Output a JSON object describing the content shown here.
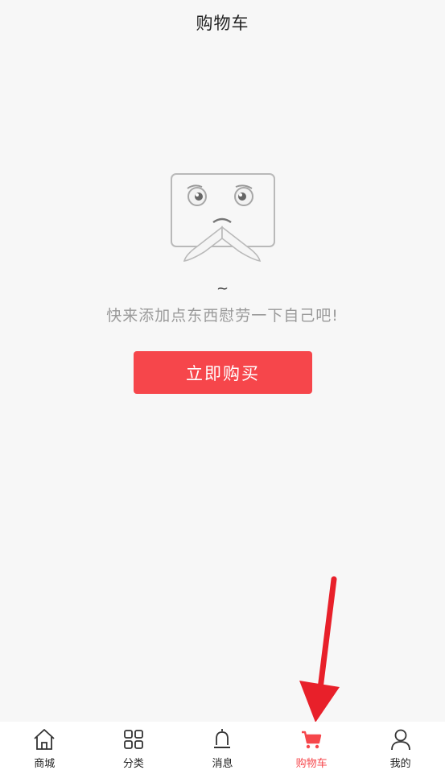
{
  "header": {
    "title": "购物车"
  },
  "empty_state": {
    "tilde": "~",
    "message": "快来添加点东西慰劳一下自己吧!",
    "button_label": "立即购买"
  },
  "tabbar": {
    "active_color": "#f6464b",
    "items": [
      {
        "label": "商城",
        "icon": "home-icon"
      },
      {
        "label": "分类",
        "icon": "grid-icon"
      },
      {
        "label": "消息",
        "icon": "bell-icon"
      },
      {
        "label": "购物车",
        "icon": "cart-icon",
        "active": true
      },
      {
        "label": "我的",
        "icon": "user-icon"
      }
    ]
  },
  "accent_color": "#f6464b"
}
